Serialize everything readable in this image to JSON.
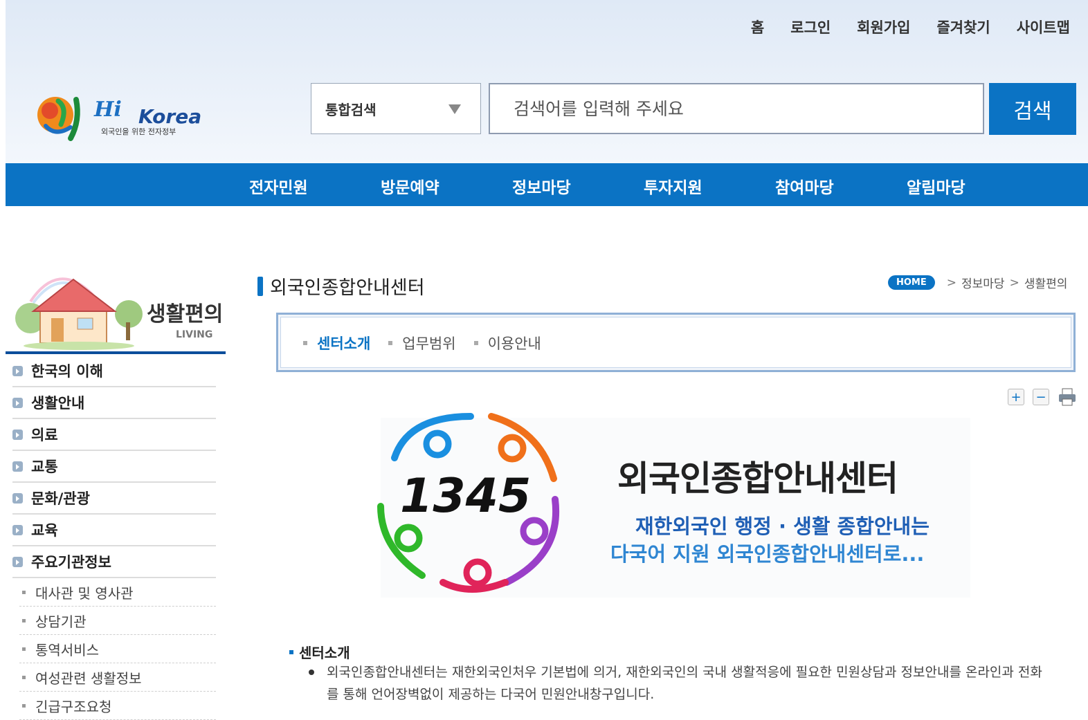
{
  "top_links": [
    "홈",
    "로그인",
    "회원가입",
    "즐겨찾기",
    "사이트맵"
  ],
  "logo": {
    "text": "Korea",
    "subtitle": "외국인을 위한 전자정부"
  },
  "search": {
    "scope": "통합검색",
    "placeholder": "검색어를 입력해 주세요",
    "button": "검색"
  },
  "gnb": [
    "전자민원",
    "방문예약",
    "정보마당",
    "투자지원",
    "참여마당",
    "알림마당"
  ],
  "side": {
    "banner_title": "생활편의",
    "banner_sub": "LIVING",
    "menu": [
      "한국의 이해",
      "생활안내",
      "의료",
      "교통",
      "문화/관광",
      "교육",
      "주요기관정보"
    ],
    "submenu": [
      "대사관 및 영사관",
      "상담기관",
      "통역서비스",
      "여성관련 생활정보",
      "긴급구조요청"
    ]
  },
  "page": {
    "title": "외국인종합안내센터",
    "breadcrumb": {
      "home": "HOME",
      "items": [
        "정보마당",
        "생활편의"
      ]
    },
    "tabs": [
      "센터소개",
      "업무범위",
      "이용안내"
    ],
    "active_tab": "센터소개"
  },
  "hero": {
    "number": "1345",
    "title": "외국인종합안내센터",
    "line1": "재한외국인 행정 · 생활 종합안내는",
    "line2": "다국어 지원 외국인종합안내센터로..."
  },
  "section": {
    "heading": "센터소개",
    "body": "외국인종합안내센터는 재한외국인처우 기본법에 의거, 재한외국인의 국내 생활적응에 필요한 민원상담과 정보안내를 온라인과 전화를 통해 언어장벽없이 제공하는 다국어 민원안내창구입니다."
  },
  "colors": {
    "primary": "#0b73c4",
    "sidebar_line": "#0b4e9b"
  }
}
